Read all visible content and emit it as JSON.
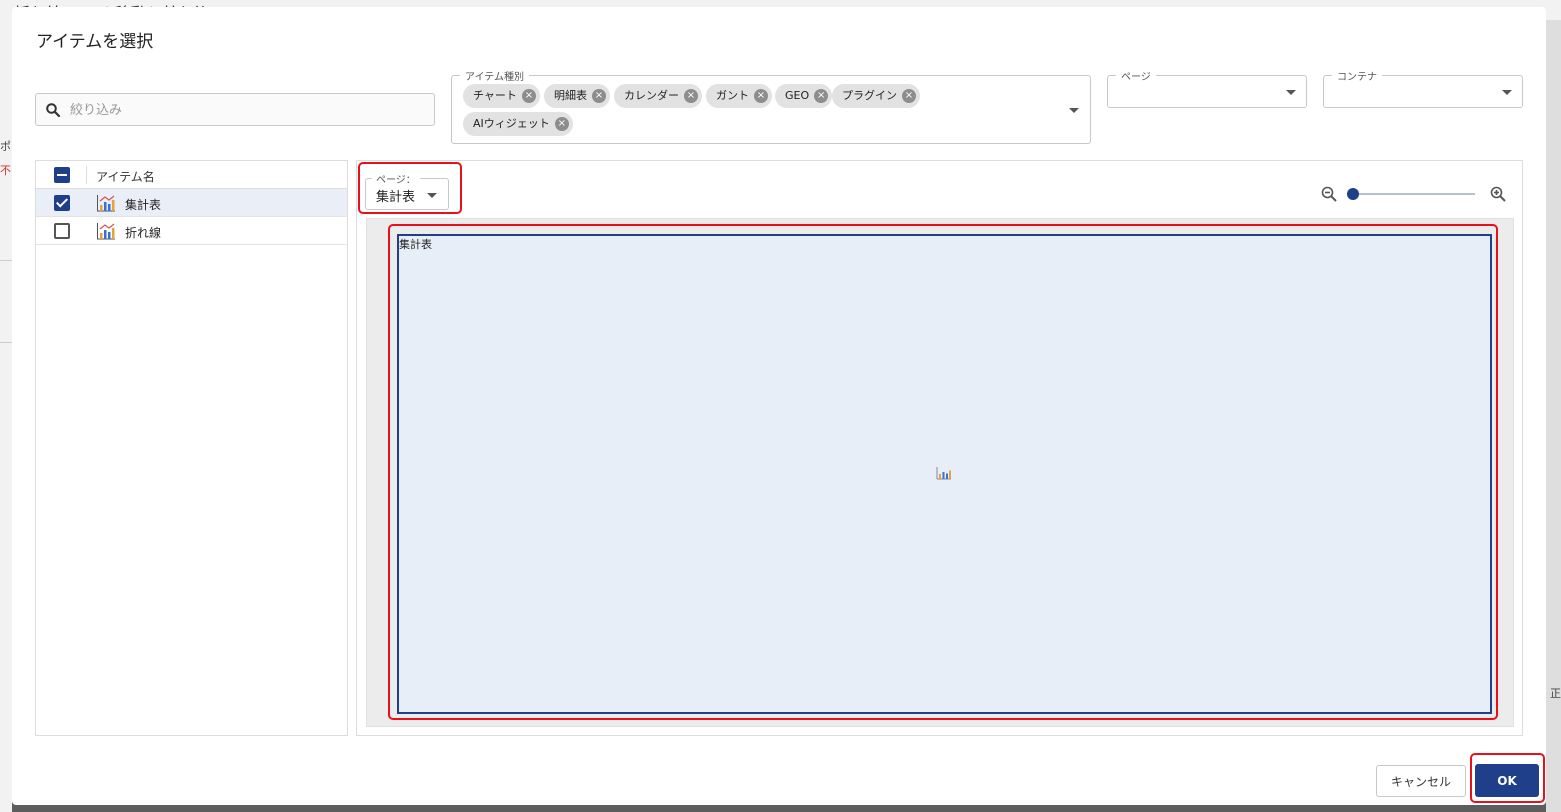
{
  "background": {
    "title_fragment": "折れ線ページ 移動と絞り込み",
    "left_fragment_1": "ポ",
    "left_fragment_2": "不",
    "right_fragment": "正"
  },
  "dialog": {
    "title": "アイテムを選択"
  },
  "search": {
    "placeholder": "絞り込み",
    "value": ""
  },
  "filters": {
    "item_type": {
      "label": "アイテム種別",
      "chips": [
        "チャート",
        "明細表",
        "カレンダー",
        "ガント",
        "GEO",
        "プラグイン",
        "AIウィジェット"
      ]
    },
    "page": {
      "label": "ページ",
      "value": ""
    },
    "container": {
      "label": "コンテナ",
      "value": ""
    }
  },
  "list": {
    "header": "アイテム名",
    "header_checkbox_state": "indeterminate",
    "items": [
      {
        "name": "集計表",
        "checked": true,
        "selected": true,
        "icon": "chart-icon"
      },
      {
        "name": "折れ線",
        "checked": false,
        "selected": false,
        "icon": "chart-icon"
      }
    ]
  },
  "preview": {
    "page_label": "ページ：",
    "page_value": "集計表",
    "zoom_level": 0,
    "item_title": "集計表"
  },
  "footer": {
    "cancel": "キャンセル",
    "ok": "OK"
  },
  "colors": {
    "primary": "#1f3f8a",
    "highlight": "#e8101a",
    "chip_bg": "#e2e2e2",
    "item_bg": "#e8eef8"
  }
}
